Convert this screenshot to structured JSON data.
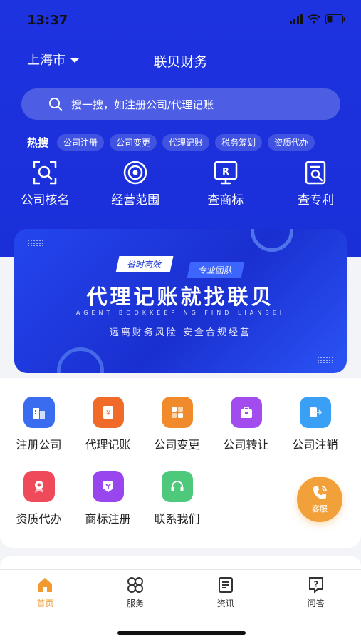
{
  "status_bar": {
    "time": "13:37"
  },
  "header": {
    "city": "上海市",
    "title": "联贝财务"
  },
  "search": {
    "placeholder": "搜一搜，如注册公司/代理记账"
  },
  "hot_search": {
    "label": "热搜",
    "chips": [
      "公司注册",
      "公司变更",
      "代理记账",
      "税务筹划",
      "资质代办"
    ]
  },
  "quick_links": [
    {
      "label": "公司核名",
      "icon": "scan-search-icon"
    },
    {
      "label": "经营范围",
      "icon": "target-icon"
    },
    {
      "label": "查商标",
      "icon": "trademark-monitor-icon"
    },
    {
      "label": "查专利",
      "icon": "patent-document-icon"
    }
  ],
  "banner": {
    "tag_left": "省时高效",
    "tag_right": "专业团队",
    "slogan": "代理记账就找联贝",
    "subtitle_en": "AGENT BOOKKEEPING FIND LIANBEI",
    "subtitle_cn": "远离财务风险 安全合规经营"
  },
  "services": [
    {
      "label": "注册公司",
      "icon": "building-icon",
      "color": "#3a6cf0"
    },
    {
      "label": "代理记账",
      "icon": "ledger-icon",
      "color": "#f06a2a"
    },
    {
      "label": "公司变更",
      "icon": "change-icon",
      "color": "#f08a2a"
    },
    {
      "label": "公司转让",
      "icon": "briefcase-icon",
      "color": "#a24cf0"
    },
    {
      "label": "公司注销",
      "icon": "exit-icon",
      "color": "#3aa0f5"
    },
    {
      "label": "资质代办",
      "icon": "certificate-icon",
      "color": "#ef4a5a"
    },
    {
      "label": "商标注册",
      "icon": "trademark-icon",
      "color": "#9a46ee"
    },
    {
      "label": "联系我们",
      "icon": "headset-icon",
      "color": "#4ec87a"
    }
  ],
  "customer_service": {
    "label": "客服"
  },
  "tabbar": [
    {
      "label": "首页",
      "icon": "home-icon",
      "active": true
    },
    {
      "label": "服务",
      "icon": "grid-icon",
      "active": false
    },
    {
      "label": "资讯",
      "icon": "news-icon",
      "active": false
    },
    {
      "label": "问答",
      "icon": "question-icon",
      "active": false
    }
  ],
  "colors": {
    "brand_blue": "#1e33e0",
    "accent_orange": "#f29a2e"
  }
}
